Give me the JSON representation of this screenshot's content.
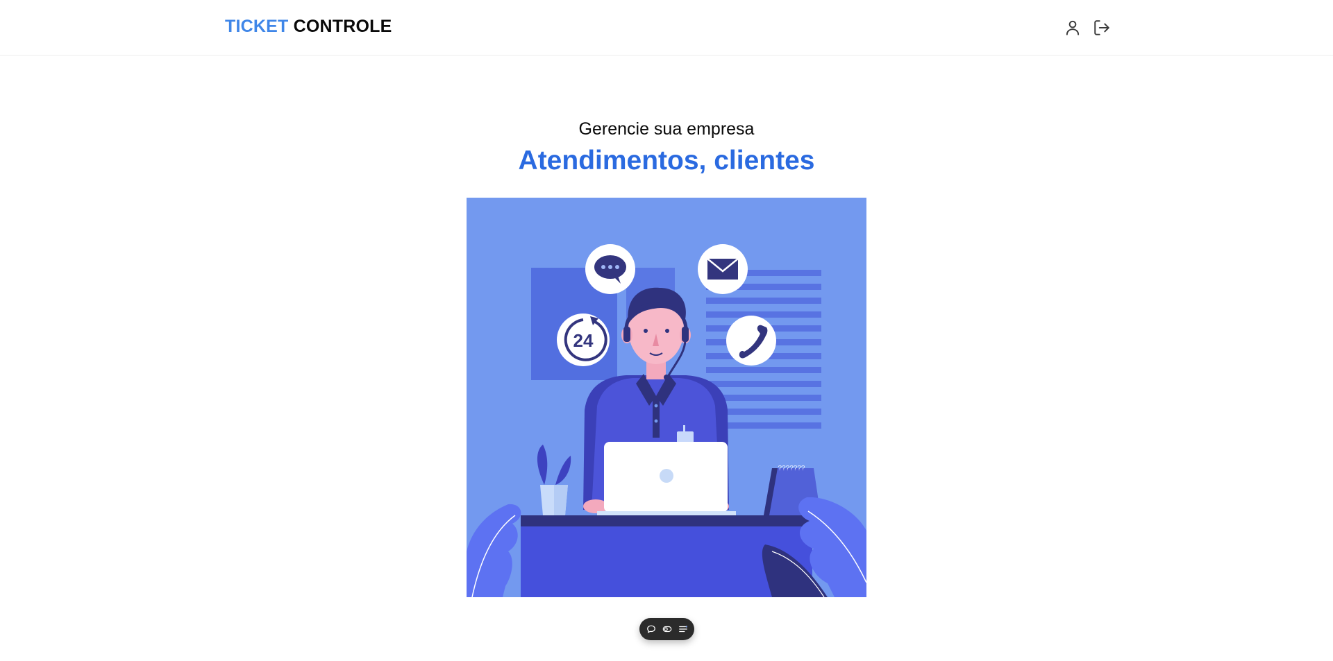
{
  "header": {
    "brand_part1": "TICKET",
    "brand_part2": "CONTROLE",
    "profile_icon": "user-icon",
    "logout_icon": "logout-icon"
  },
  "hero": {
    "subtitle": "Gerencie sua empresa",
    "headline": "Atendimentos, clientes",
    "illustration": "customer-support-agent-illustration",
    "badge_24": "24",
    "sign_text": "???????"
  },
  "toolbar": {
    "icons": [
      "comment-icon",
      "toggle-icon",
      "settings-sliders-icon"
    ]
  },
  "colors": {
    "brand_blue": "#3f86e8",
    "headline_blue": "#2a6ae0",
    "illustration_bg": "#7399ef"
  }
}
